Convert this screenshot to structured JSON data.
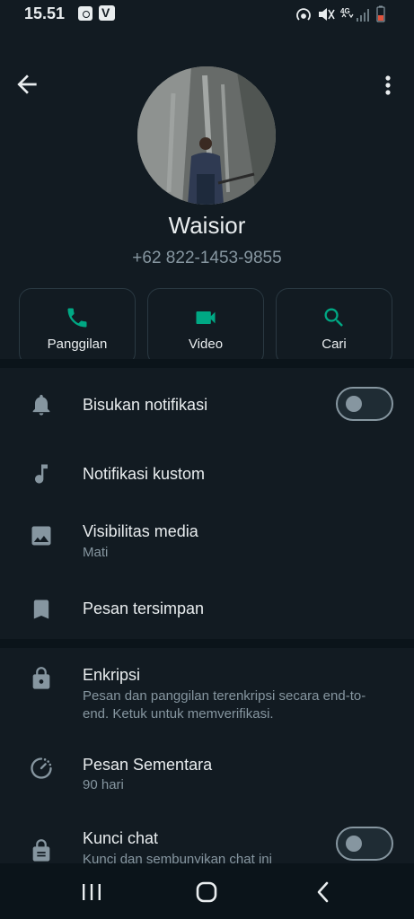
{
  "status_bar": {
    "time": "15.51",
    "icons": [
      "camera-app-icon",
      "v-app-icon",
      "hotspot-icon",
      "mute-icon",
      "4g-icon",
      "signal-icon",
      "battery-icon"
    ],
    "network": "4G"
  },
  "header": {
    "back_icon": "arrow-left-icon",
    "menu_icon": "more-vert-icon",
    "contact_name": "Waisior",
    "phone": "+62 822-1453-9855"
  },
  "actions": [
    {
      "label": "Panggilan",
      "icon": "phone-icon"
    },
    {
      "label": "Video",
      "icon": "videocam-icon"
    },
    {
      "label": "Cari",
      "icon": "search-icon"
    }
  ],
  "settings": {
    "mute": {
      "title": "Bisukan notifikasi",
      "icon": "bell-icon",
      "enabled": false
    },
    "custom_notif": {
      "title": "Notifikasi kustom",
      "icon": "music-note-icon"
    },
    "media": {
      "title": "Visibilitas media",
      "subtitle": "Mati",
      "icon": "image-icon"
    },
    "saved": {
      "title": "Pesan tersimpan",
      "icon": "bookmark-icon"
    },
    "encryption": {
      "title": "Enkripsi",
      "subtitle": "Pesan dan panggilan terenkripsi secara end-to-end. Ketuk untuk memverifikasi.",
      "icon": "lock-icon"
    },
    "disappearing": {
      "title": "Pesan Sementara",
      "subtitle": "90 hari",
      "icon": "timer-icon"
    },
    "chat_lock": {
      "title": "Kunci chat",
      "subtitle": "Kunci dan sembunyikan chat ini",
      "icon": "lock-chat-icon",
      "enabled": false
    }
  },
  "colors": {
    "background": "#121b22",
    "divider": "#0b141a",
    "accent": "#00a884",
    "text_primary": "#e9edef",
    "text_secondary": "#8696a0"
  },
  "nav_bar": {
    "buttons": [
      "recents-icon",
      "home-icon",
      "back-nav-icon"
    ]
  }
}
